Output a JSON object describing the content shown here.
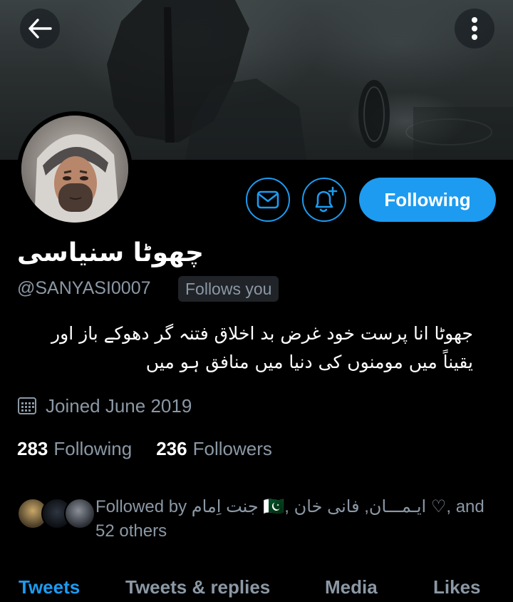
{
  "header": {
    "back_icon": "arrow-left-icon",
    "more_icon": "more-vertical-icon"
  },
  "actions": {
    "message_icon": "mail-icon",
    "notify_icon": "bell-plus-icon",
    "following_label": "Following"
  },
  "profile": {
    "display_name": "چھوٹا سنیاسی",
    "handle": "@SANYASI0007",
    "follows_you": "Follows you",
    "bio_line1": "جھوٹا انا پرست خود غرض بد اخلاق فتنہ گر دھوکے باز اور",
    "bio_line2": "یقیناً میں مومنوں کی دنیا میں منافق ہو میں",
    "joined": "Joined June 2019",
    "calendar_icon": "calendar-icon"
  },
  "stats": {
    "following_count": "283",
    "following_label": "Following",
    "followers_count": "236",
    "followers_label": "Followers"
  },
  "followed_by": {
    "line1": "Followed by جنت اِمام 🇵🇰, ایـمـــان, فانی خان ♡, and",
    "line2": "52 others"
  },
  "tabs": [
    "Tweets",
    "Tweets & replies",
    "Media",
    "Likes"
  ],
  "colors": {
    "accent": "#1d9bf0",
    "background": "#000000",
    "secondary_text": "#8b98a5"
  }
}
